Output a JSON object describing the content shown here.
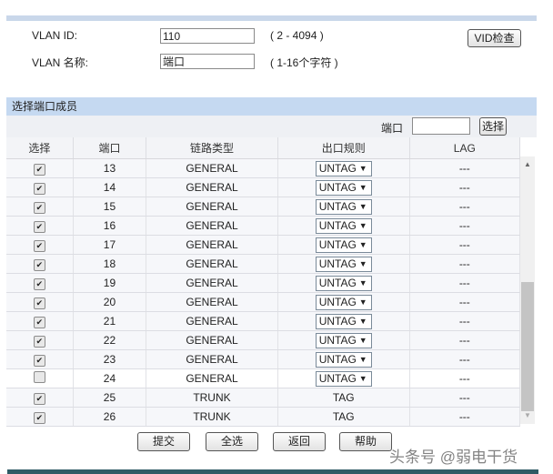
{
  "vlan": {
    "id_label": "VLAN ID:",
    "id_value": "110",
    "id_hint": "( 2 - 4094 )",
    "name_label": "VLAN 名称:",
    "name_value": "端口",
    "name_hint": "( 1-16个字符 )",
    "check_button": "VID检查"
  },
  "section": {
    "title": "选择端口成员",
    "port_label": "端口",
    "port_value": "",
    "select_button": "选择"
  },
  "table": {
    "headers": [
      "选择",
      "端口",
      "链路类型",
      "出口规则",
      "LAG"
    ],
    "rows": [
      {
        "checked": true,
        "port": "13",
        "type": "GENERAL",
        "rule": "UNTAG",
        "dropdown": true,
        "lag": "---"
      },
      {
        "checked": true,
        "port": "14",
        "type": "GENERAL",
        "rule": "UNTAG",
        "dropdown": true,
        "lag": "---"
      },
      {
        "checked": true,
        "port": "15",
        "type": "GENERAL",
        "rule": "UNTAG",
        "dropdown": true,
        "lag": "---"
      },
      {
        "checked": true,
        "port": "16",
        "type": "GENERAL",
        "rule": "UNTAG",
        "dropdown": true,
        "lag": "---"
      },
      {
        "checked": true,
        "port": "17",
        "type": "GENERAL",
        "rule": "UNTAG",
        "dropdown": true,
        "lag": "---"
      },
      {
        "checked": true,
        "port": "18",
        "type": "GENERAL",
        "rule": "UNTAG",
        "dropdown": true,
        "lag": "---"
      },
      {
        "checked": true,
        "port": "19",
        "type": "GENERAL",
        "rule": "UNTAG",
        "dropdown": true,
        "lag": "---"
      },
      {
        "checked": true,
        "port": "20",
        "type": "GENERAL",
        "rule": "UNTAG",
        "dropdown": true,
        "lag": "---"
      },
      {
        "checked": true,
        "port": "21",
        "type": "GENERAL",
        "rule": "UNTAG",
        "dropdown": true,
        "lag": "---"
      },
      {
        "checked": true,
        "port": "22",
        "type": "GENERAL",
        "rule": "UNTAG",
        "dropdown": true,
        "lag": "---"
      },
      {
        "checked": true,
        "port": "23",
        "type": "GENERAL",
        "rule": "UNTAG",
        "dropdown": true,
        "lag": "---"
      },
      {
        "checked": false,
        "port": "24",
        "type": "GENERAL",
        "rule": "UNTAG",
        "dropdown": true,
        "lag": "---"
      },
      {
        "checked": true,
        "port": "25",
        "type": "TRUNK",
        "rule": "TAG",
        "dropdown": false,
        "lag": "---"
      },
      {
        "checked": true,
        "port": "26",
        "type": "TRUNK",
        "rule": "TAG",
        "dropdown": false,
        "lag": "---"
      }
    ]
  },
  "buttons": {
    "submit": "提交",
    "select_all": "全选",
    "back": "返回",
    "help": "帮助"
  },
  "watermark": "头条号 @弱电干货"
}
